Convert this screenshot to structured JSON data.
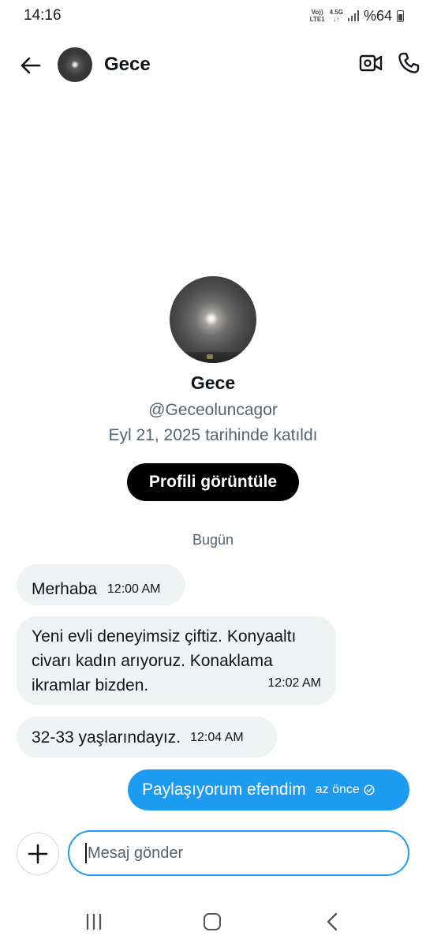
{
  "status_bar": {
    "time": "14:16",
    "volte": "Vo))",
    "lte": "LTE1",
    "network": "4.5G",
    "battery": "%64"
  },
  "header": {
    "title": "Gece",
    "back_icon": "arrow-left-icon",
    "video_icon": "video-call-icon",
    "phone_icon": "phone-icon"
  },
  "profile": {
    "name": "Gece",
    "handle": "@Geceoluncagor",
    "joined": "Eyl 21, 2025 tarihinde katıldı",
    "view_button": "Profili görüntüle"
  },
  "conversation": {
    "date_separator": "Bugün",
    "incoming": [
      {
        "lines": [
          "Merhaba"
        ],
        "time": "12:00 AM"
      },
      {
        "lines": [
          "Yeni evli deneyimsiz çiftiz. Konyaaltı",
          "civarı kadın arıyoruz. Konaklama",
          "ikramlar bizden."
        ],
        "time": "12:02 AM"
      },
      {
        "lines": [
          "32-33 yaşlarındayız."
        ],
        "time": "12:04 AM"
      }
    ],
    "outgoing": [
      {
        "text": "Paylaşıyorum efendim",
        "time": "az önce"
      }
    ]
  },
  "composer": {
    "placeholder": "Mesaj gönder"
  },
  "colors": {
    "accent": "#1d9bf0",
    "bubble_in": "#eff3f4",
    "secondary_text": "#536471"
  }
}
